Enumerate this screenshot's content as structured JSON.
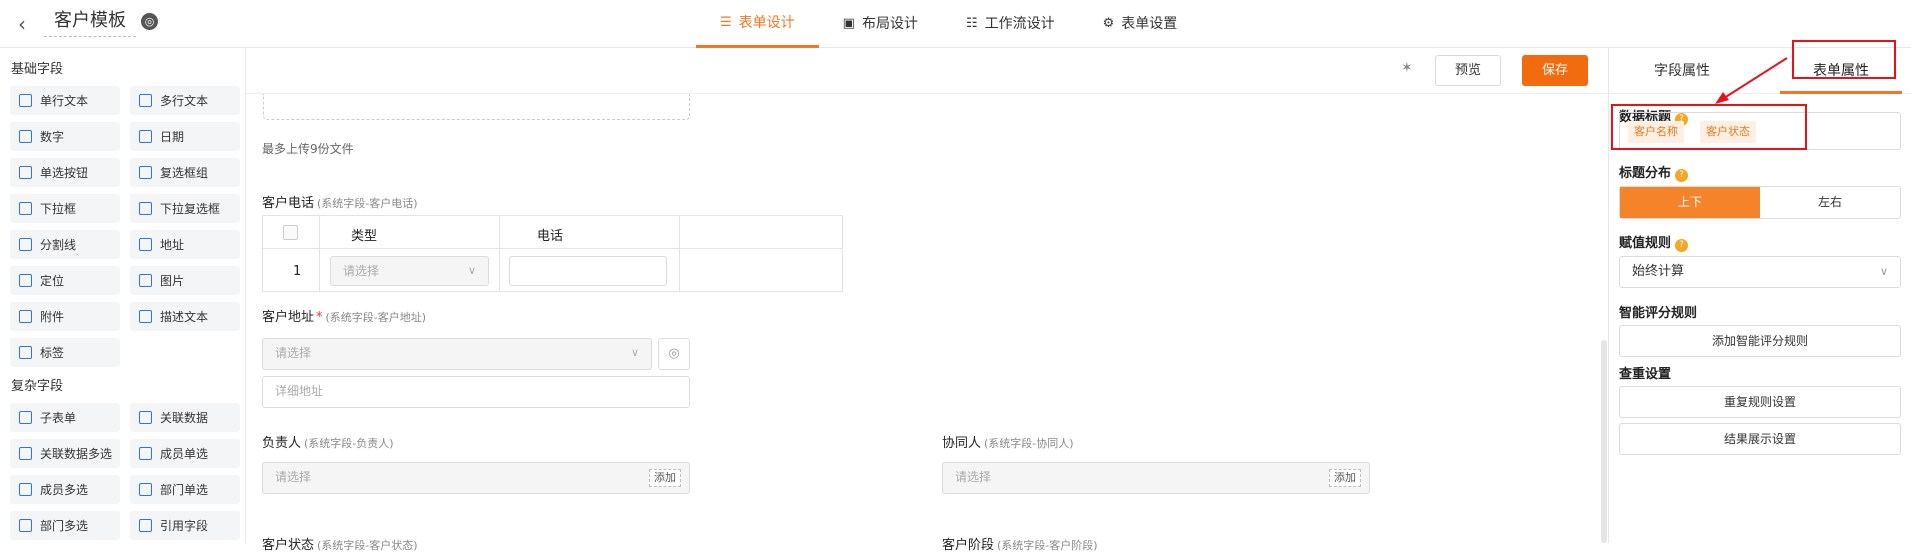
{
  "header": {
    "back_icon": "chevron-left-icon",
    "title": "客户模板",
    "globe_icon": "globe-icon",
    "tabs": [
      {
        "label": "表单设计",
        "icon": "form-icon"
      },
      {
        "label": "布局设计",
        "icon": "layout-icon"
      },
      {
        "label": "工作流设计",
        "icon": "workflow-icon"
      },
      {
        "label": "表单设置",
        "icon": "gear-icon"
      }
    ]
  },
  "left": {
    "basic_title": "基础字段",
    "basic_fields": [
      "单行文本",
      "多行文本",
      "数字",
      "日期",
      "单选按钮",
      "复选框组",
      "下拉框",
      "下拉复选框",
      "分割线",
      "地址",
      "定位",
      "图片",
      "附件",
      "描述文本",
      "标签"
    ],
    "complex_title": "复杂字段",
    "complex_fields": [
      "子表单",
      "关联数据",
      "关联数据多选",
      "成员单选",
      "成员多选",
      "部门单选",
      "部门多选",
      "引用字段"
    ]
  },
  "toolbar": {
    "preview": "预览",
    "save": "保存"
  },
  "form": {
    "upload_hint": "最多上传9份文件",
    "phone_label": "客户电话",
    "phone_sys": "(系统字段-客户电话)",
    "col_type": "类型",
    "col_phone": "电话",
    "row_num": "1",
    "select_placeholder": "请选择",
    "address_label": "客户地址",
    "required_mark": "*",
    "address_sys": "(系统字段-客户地址)",
    "detail_placeholder": "详细地址",
    "owner_label": "负责人",
    "owner_sys": "(系统字段-负责人)",
    "collab_label": "协同人",
    "collab_sys": "(系统字段-协同人)",
    "add_label": "添加",
    "status_label": "客户状态",
    "status_sys": "(系统字段-客户状态)",
    "stage_label": "客户阶段",
    "stage_sys": "(系统字段-客户阶段)"
  },
  "right": {
    "tab_field": "字段属性",
    "tab_form": "表单属性",
    "data_title": "数据标题",
    "tags": [
      "客户名称",
      "客户状态"
    ],
    "title_layout": "标题分布",
    "layout_opts": [
      "上下",
      "左右"
    ],
    "assign_rule": "赋值规则",
    "assign_value": "始终计算",
    "smart_score": "智能评分规则",
    "add_smart": "添加智能评分规则",
    "dedup": "查重设置",
    "dup_rule": "重复规则设置",
    "result_show": "结果展示设置"
  },
  "colors": {
    "accent": "#f27623",
    "annotation_red": "#e8121b"
  }
}
